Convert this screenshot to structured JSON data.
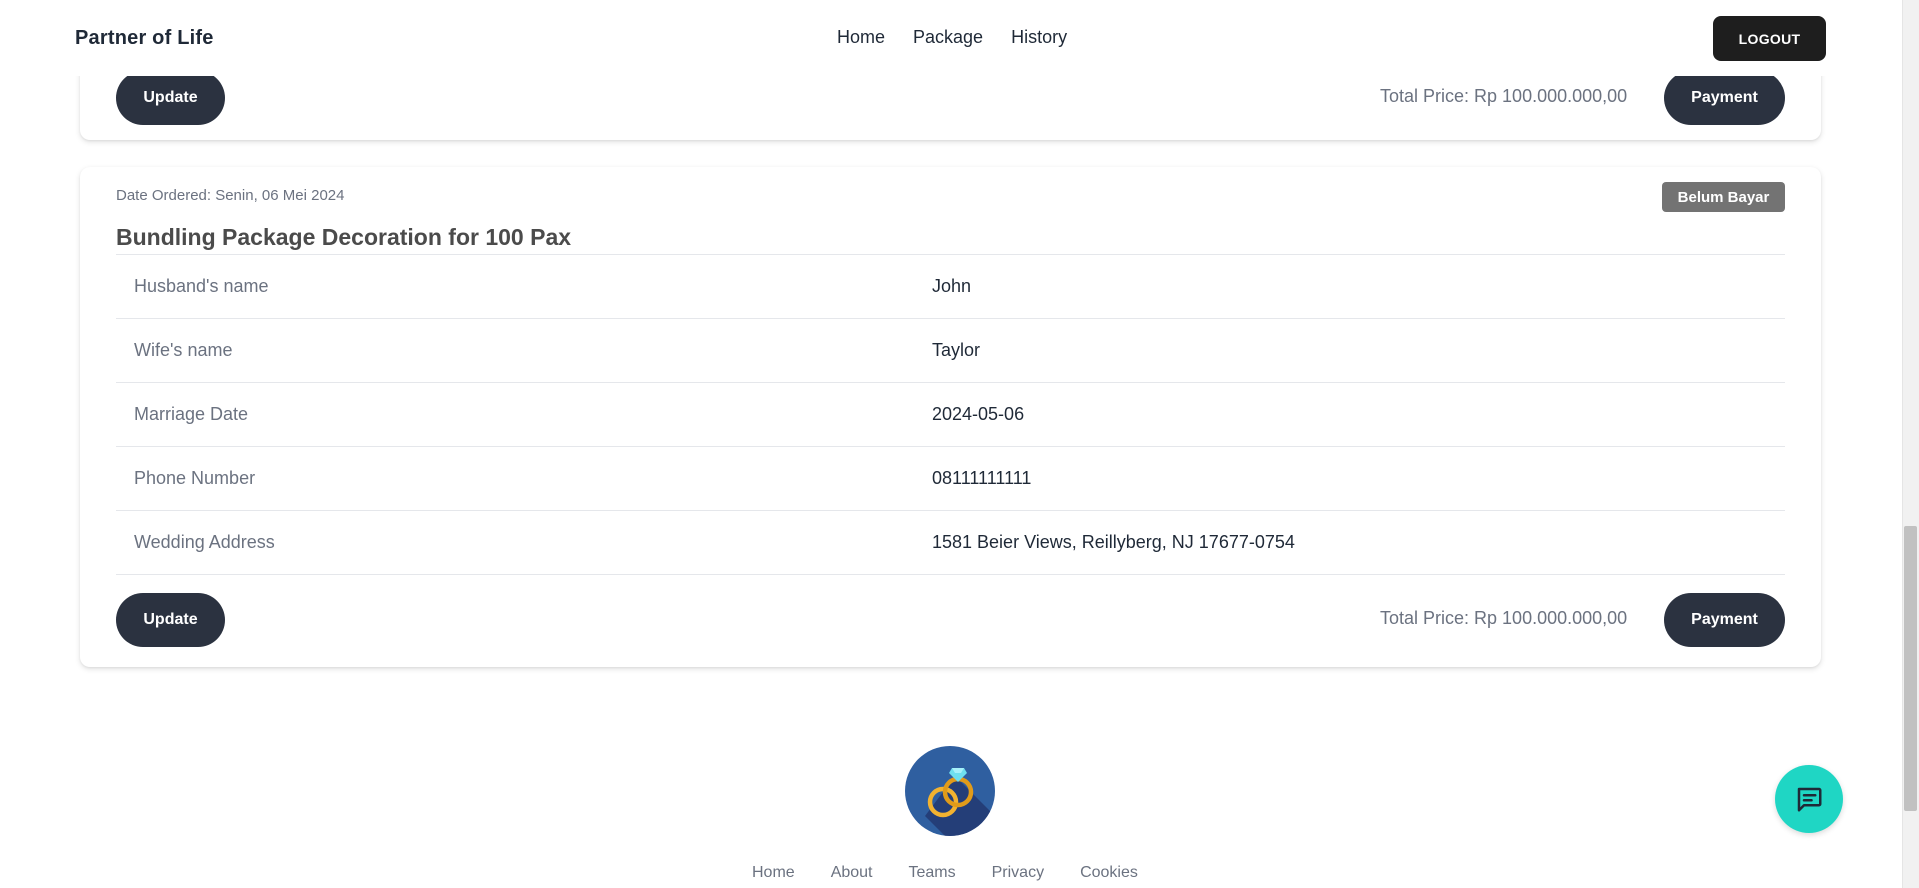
{
  "header": {
    "brand": "Partner of Life",
    "nav": [
      "Home",
      "Package",
      "History"
    ],
    "logout_label": "LOGOUT"
  },
  "order_prev": {
    "update_label": "Update",
    "total_price": "Total Price: Rp 100.000.000,00",
    "payment_label": "Payment"
  },
  "order": {
    "date_ordered": "Date Ordered: Senin, 06 Mei 2024",
    "status": "Belum Bayar",
    "title": "Bundling Package Decoration for 100 Pax",
    "details": [
      {
        "label": "Husband's name",
        "value": "John"
      },
      {
        "label": "Wife's name",
        "value": "Taylor"
      },
      {
        "label": "Marriage Date",
        "value": "2024-05-06"
      },
      {
        "label": "Phone Number",
        "value": "08111111111"
      },
      {
        "label": "Wedding Address",
        "value": "1581 Beier Views, Reillyberg, NJ 17677-0754"
      }
    ],
    "update_label": "Update",
    "total_price": "Total Price: Rp 100.000.000,00",
    "payment_label": "Payment"
  },
  "footer": {
    "logo_icon": "wedding-rings-icon",
    "links": [
      "Home",
      "About",
      "Teams",
      "Privacy",
      "Cookies"
    ]
  },
  "chat": {
    "icon": "chat-message-icon"
  },
  "colors": {
    "dark_button": "#2b3240",
    "logout_button": "#1e1e1e",
    "status_badge": "#737373",
    "chat_fab": "#1fd6c4",
    "logo_bg": "#2f5fa0"
  }
}
